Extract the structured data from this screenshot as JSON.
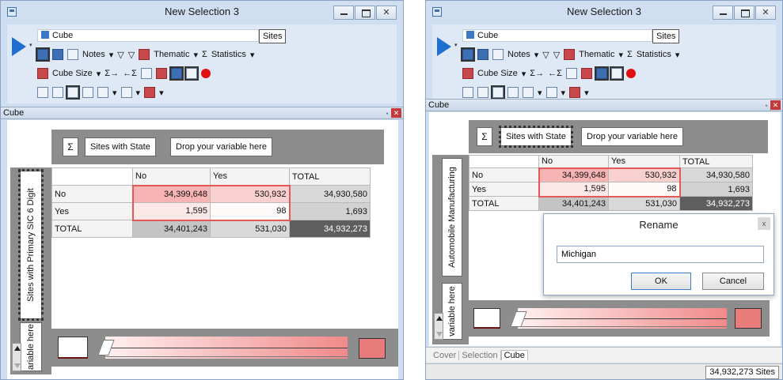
{
  "left": {
    "title": "New Selection 3",
    "window_buttons": {
      "close": "✕"
    },
    "toolbar": {
      "cube_field": "Cube",
      "sites_label": "Sites",
      "notes_label": "Notes",
      "thematic_label": "Thematic",
      "statistics_label": "Statistics",
      "cube_size_label": "Cube Size",
      "sigma": "Σ",
      "arrow": "▾"
    },
    "panel": {
      "title": "Cube",
      "close": "✕"
    },
    "cube": {
      "sigma": "Σ",
      "col_var": "Sites with State",
      "col_drop": "Drop your variable here",
      "row_var": "Sites with Primary SIC 6 Digit",
      "row_drop": "ariable here",
      "columns": [
        "No",
        "Yes",
        "TOTAL"
      ],
      "rows": [
        {
          "label": "No",
          "values": [
            "34,399,648",
            "530,932",
            "34,930,580"
          ]
        },
        {
          "label": "Yes",
          "values": [
            "1,595",
            "98",
            "1,693"
          ]
        },
        {
          "label": "TOTAL",
          "values": [
            "34,401,243",
            "531,030",
            "34,932,273"
          ]
        }
      ]
    },
    "colors": {
      "heat_max": "#f7b4b4",
      "heat_min": "#fffafa",
      "selection": "#e45858",
      "legend_max": "#ea7b7b"
    }
  },
  "right": {
    "title": "New Selection 3",
    "window_buttons": {
      "close": "✕"
    },
    "toolbar": {
      "cube_field": "Cube",
      "sites_label": "Sites",
      "notes_label": "Notes",
      "thematic_label": "Thematic",
      "statistics_label": "Statistics",
      "cube_size_label": "Cube Size",
      "sigma": "Σ",
      "arrow": "▾"
    },
    "panel": {
      "title": "Cube",
      "close": "✕"
    },
    "cube": {
      "sigma": "Σ",
      "col_var": "Sites with State",
      "col_drop": "Drop your variable here",
      "row_var": "Automobile Manufacturing",
      "row_drop": "variable here",
      "columns": [
        "No",
        "Yes",
        "TOTAL"
      ],
      "rows": [
        {
          "label": "No",
          "values": [
            "34,399,648",
            "530,932",
            "34,930,580"
          ]
        },
        {
          "label": "Yes",
          "values": [
            "1,595",
            "98",
            "1,693"
          ]
        },
        {
          "label": "TOTAL",
          "values": [
            "34,401,243",
            "531,030",
            "34,932,273"
          ]
        }
      ]
    },
    "dialog": {
      "title": "Rename",
      "close": "x",
      "input_value": "Michigan",
      "ok": "OK",
      "cancel": "Cancel"
    },
    "tabs": [
      "Cover",
      "Selection",
      "Cube"
    ],
    "active_tab": "Cube",
    "status": "34,932,273 Sites"
  }
}
